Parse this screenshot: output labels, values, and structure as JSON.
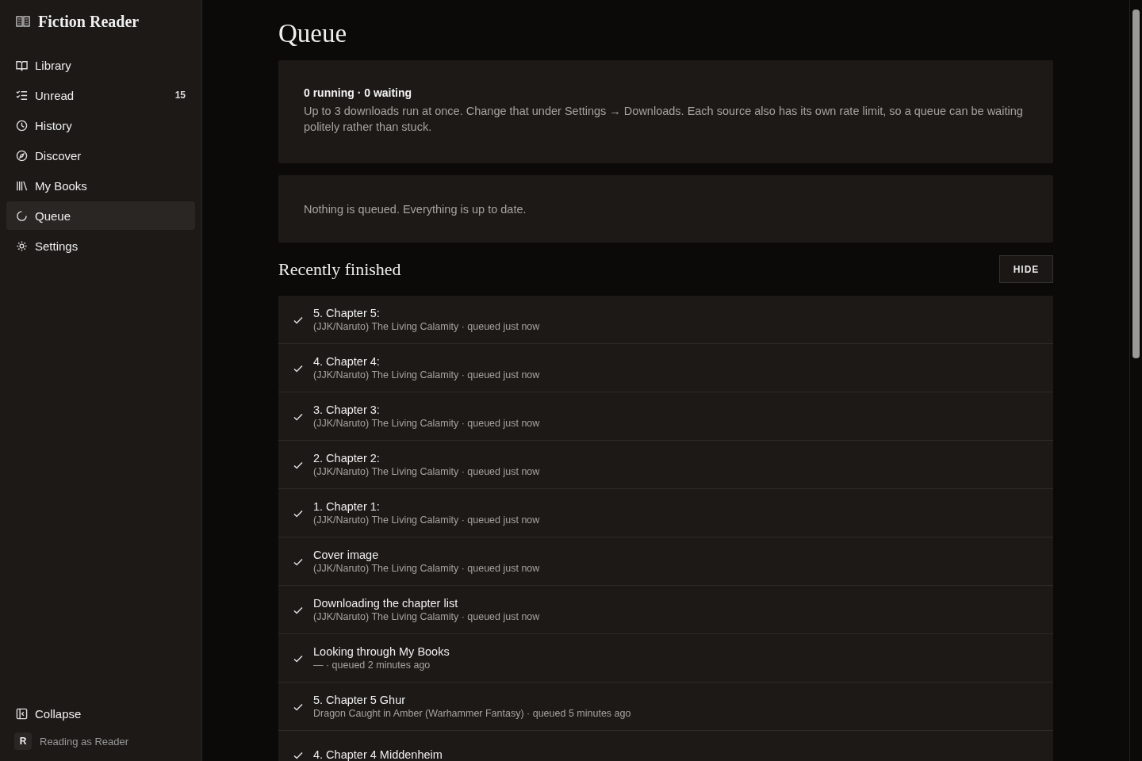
{
  "sidebar": {
    "brand": "Fiction Reader",
    "items": [
      {
        "label": "Library",
        "selected": false
      },
      {
        "label": "Unread",
        "selected": false,
        "badge": "15"
      },
      {
        "label": "History",
        "selected": false
      },
      {
        "label": "Discover",
        "selected": false
      },
      {
        "label": "My Books",
        "selected": false
      },
      {
        "label": "Queue",
        "selected": true
      },
      {
        "label": "Settings",
        "selected": false
      }
    ],
    "collapse": "Collapse",
    "user_initial": "R",
    "user_text": "Reading as Reader"
  },
  "page": {
    "title": "Queue",
    "summary": {
      "counts": "0 running · 0 waiting",
      "text": "Up to 3 downloads run at once. Change that under Settings → Downloads. Each source also has its own rate limit, so a queue can be waiting politely rather than stuck."
    },
    "empty_message": "Nothing is queued. Everything is up to date.",
    "recent_title": "Recently finished",
    "hide_button": "HIDE",
    "recent": [
      {
        "title": "5. Chapter 5:",
        "meta": "(JJK/Naruto) The Living Calamity · queued just now",
        "done": true
      },
      {
        "title": "4. Chapter 4:",
        "meta": "(JJK/Naruto) The Living Calamity · queued just now",
        "done": true
      },
      {
        "title": "3. Chapter 3:",
        "meta": "(JJK/Naruto) The Living Calamity · queued just now",
        "done": true
      },
      {
        "title": "2. Chapter 2:",
        "meta": "(JJK/Naruto) The Living Calamity · queued just now",
        "done": true
      },
      {
        "title": "1. Chapter 1:",
        "meta": "(JJK/Naruto) The Living Calamity · queued just now",
        "done": true
      },
      {
        "title": "Cover image",
        "meta": "(JJK/Naruto) The Living Calamity · queued just now",
        "done": true
      },
      {
        "title": "Downloading the chapter list",
        "meta": "(JJK/Naruto) The Living Calamity · queued just now",
        "done": true
      },
      {
        "title": "Looking through My Books",
        "meta": "— · queued 2 minutes ago",
        "done": true
      },
      {
        "title": "5. Chapter 5 Ghur",
        "meta": "Dragon Caught in Amber (Warhammer Fantasy) · queued 5 minutes ago",
        "done": true
      },
      {
        "title": "4. Chapter 4 Middenheim",
        "done": true
      }
    ]
  }
}
